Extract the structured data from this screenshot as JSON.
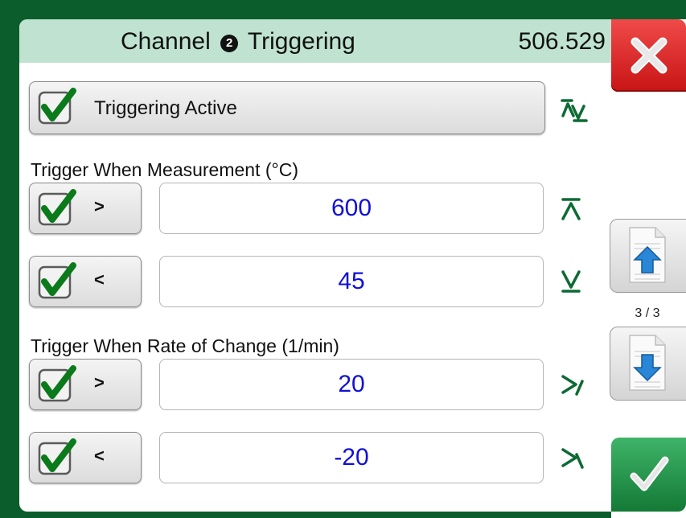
{
  "header": {
    "title_before": "Channel",
    "channel_number": "2",
    "title_after": "Triggering",
    "reading": "506.529"
  },
  "triggering_active": {
    "label": "Triggering Active",
    "checked": true
  },
  "measurement": {
    "section_label": "Trigger When Measurement (°C)",
    "rows": [
      {
        "operator": ">",
        "value": "600",
        "checked": true
      },
      {
        "operator": "<",
        "value": "45",
        "checked": true
      }
    ]
  },
  "rate": {
    "section_label": "Trigger When Rate of Change (1/min)",
    "rows": [
      {
        "operator": ">",
        "value": "20",
        "checked": true
      },
      {
        "operator": "<",
        "value": "-20",
        "checked": true
      }
    ]
  },
  "sidebar": {
    "page_indicator": "3 / 3",
    "close_icon": "close-icon",
    "page_up_icon": "page-up-icon",
    "page_down_icon": "page-down-icon",
    "accept_icon": "checkmark-icon"
  },
  "colors": {
    "frame": "#0b5e2c",
    "header": "#bfe3d0",
    "value_text": "#1010d8",
    "close": "#d82020",
    "accept": "#1f8a42",
    "trigger_icon": "#0d6b34"
  }
}
